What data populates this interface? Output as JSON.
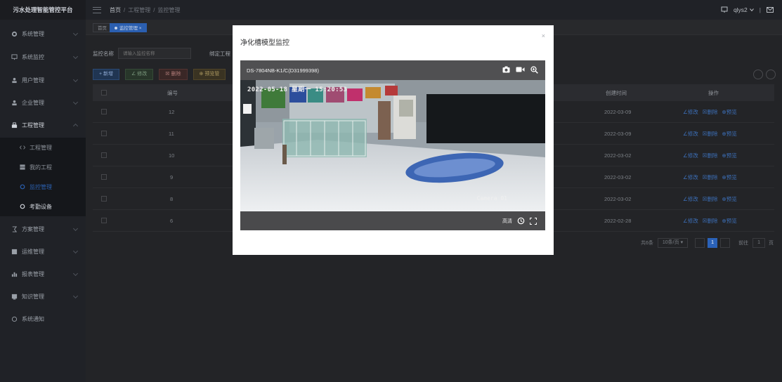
{
  "app": {
    "title": "污水处理智能管控平台"
  },
  "sidebar": {
    "items": [
      {
        "label": "系统管理",
        "icon": "gear-icon"
      },
      {
        "label": "系统监控",
        "icon": "monitor-icon"
      },
      {
        "label": "用户管理",
        "icon": "user-icon"
      },
      {
        "label": "企业管理",
        "icon": "enterprise-icon"
      },
      {
        "label": "工程管理",
        "icon": "engineering-icon"
      },
      {
        "label": "方案管理",
        "icon": "plan-icon"
      },
      {
        "label": "运维管理",
        "icon": "maintenance-icon"
      },
      {
        "label": "报表管理",
        "icon": "report-icon"
      },
      {
        "label": "知识管理",
        "icon": "knowledge-icon"
      },
      {
        "label": "系统通知",
        "icon": "notice-icon"
      }
    ],
    "subitems": [
      {
        "label": "工程管理",
        "icon": "code-icon"
      },
      {
        "label": "我的工程",
        "icon": "grid-icon"
      },
      {
        "label": "监控管理",
        "icon": "camera-icon"
      },
      {
        "label": "考勤设备",
        "icon": "device-icon"
      }
    ]
  },
  "header": {
    "breadcrumb": [
      "首页",
      "工程管理",
      "监控管理"
    ],
    "user": "qlys2",
    "user_icon": "monitor-icon",
    "mail_icon": "mail-icon"
  },
  "tags": [
    {
      "label": "首页"
    },
    {
      "label": "监控管理"
    }
  ],
  "search": {
    "label": "监控名称",
    "placeholder": "请输入监控名称",
    "project_label": "绑定工程"
  },
  "toolbar": {
    "add_label": "+ 新增",
    "edit_label": "∠ 修改",
    "delete_label": "☒ 删除",
    "preview_label": "⊕ 预览管"
  },
  "table": {
    "headers": {
      "number": "编号",
      "created": "创建时间",
      "actions": "操作"
    },
    "rows": [
      {
        "id": "12",
        "created": "2022-03-09"
      },
      {
        "id": "11",
        "created": "2022-03-09"
      },
      {
        "id": "10",
        "created": "2022-03-02"
      },
      {
        "id": "9",
        "created": "2022-03-02"
      },
      {
        "id": "8",
        "created": "2022-03-02"
      },
      {
        "id": "6",
        "created": "2022-02-28"
      }
    ],
    "actions": {
      "edit": "∠修改",
      "delete": "☒删除",
      "preview": "⊕预览"
    }
  },
  "pagination": {
    "total": "共6条",
    "page_size": "10条/页",
    "current": "1",
    "goto_label": "前往",
    "goto_value": "1",
    "page_unit": "页"
  },
  "modal": {
    "title": "净化槽模型监控",
    "close": "×",
    "device_name": "DS-7804NB-K1/C(D31999398)",
    "osd_time": "2022-05-18 星期一 15:20:53",
    "camera_label": "Camera 01",
    "quality_label": "高清"
  }
}
